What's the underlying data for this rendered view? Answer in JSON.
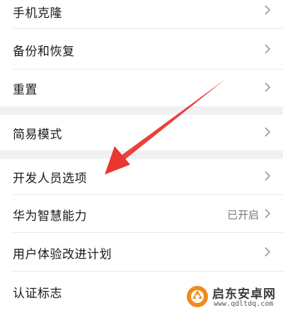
{
  "settings": {
    "items": [
      {
        "label": "手机克隆"
      },
      {
        "label": "备份和恢复"
      },
      {
        "label": "重置"
      },
      {
        "label": "简易模式"
      },
      {
        "label": "开发人员选项"
      },
      {
        "label": "华为智慧能力",
        "value": "已开启"
      },
      {
        "label": "用户体验改进计划"
      },
      {
        "label": "认证标志"
      }
    ]
  },
  "annotation": {
    "arrow_color": "#e8382f",
    "arrow_target": "开发人员选项"
  },
  "watermark": {
    "title": "启东安卓网",
    "url": "www.qdltdq.com",
    "accent": "#f08a1c"
  },
  "icons": {
    "chevron": "chevron-right-icon"
  }
}
